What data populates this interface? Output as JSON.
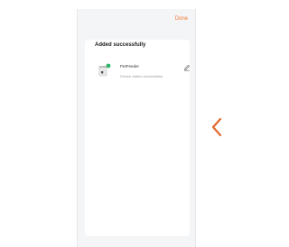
{
  "header": {
    "done_label": "Done"
  },
  "result": {
    "title": "Added successfully"
  },
  "device": {
    "name": "PetFeeder",
    "status": "Device added successfully",
    "icon": "pet-feeder-icon",
    "status_color": "#2fb36b"
  },
  "icons": {
    "edit": "pencil-icon",
    "back": "chevron-left-icon"
  },
  "colors": {
    "accent": "#f07a35"
  }
}
